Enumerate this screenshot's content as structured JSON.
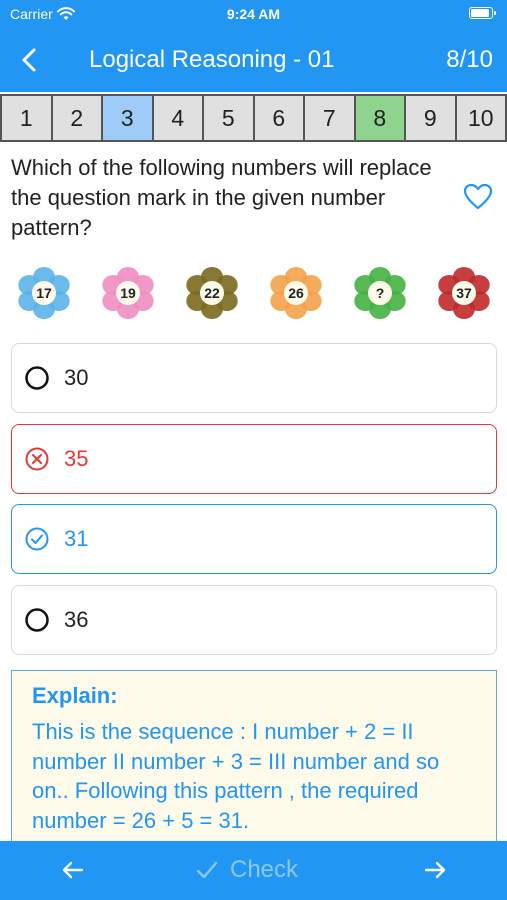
{
  "status_bar": {
    "carrier": "Carrier",
    "time": "9:24 AM"
  },
  "nav": {
    "title": "Logical Reasoning - 01",
    "progress": "8/10"
  },
  "number_strip": [
    {
      "label": "1",
      "state": "default"
    },
    {
      "label": "2",
      "state": "default"
    },
    {
      "label": "3",
      "state": "active"
    },
    {
      "label": "4",
      "state": "default"
    },
    {
      "label": "5",
      "state": "default"
    },
    {
      "label": "6",
      "state": "default"
    },
    {
      "label": "7",
      "state": "default"
    },
    {
      "label": "8",
      "state": "done"
    },
    {
      "label": "9",
      "state": "default"
    },
    {
      "label": "10",
      "state": "default"
    }
  ],
  "question": {
    "text": "Which of the following numbers will replace the question mark in the given number pattern?"
  },
  "flowers": [
    {
      "label": "17",
      "color": "#5bb3ea"
    },
    {
      "label": "19",
      "color": "#ee8ec0"
    },
    {
      "label": "22",
      "color": "#7a6a1e"
    },
    {
      "label": "26",
      "color": "#f4a24a"
    },
    {
      "label": "?",
      "color": "#45b044"
    },
    {
      "label": "37",
      "color": "#c0292b"
    }
  ],
  "options": [
    {
      "label": "30",
      "state": "normal"
    },
    {
      "label": "35",
      "state": "wrong"
    },
    {
      "label": "31",
      "state": "right"
    },
    {
      "label": "36",
      "state": "normal"
    }
  ],
  "explain": {
    "title": "Explain:",
    "text": "This is the sequence : I number + 2 = II number II number + 3 = III number and so on.. Following this pattern , the required number = 26 + 5 = 31."
  },
  "bottom_bar": {
    "check_label": "Check"
  },
  "colors": {
    "primary": "#2196f3",
    "wrong": "#e53935",
    "active_cell": "#9ecbf7",
    "done_cell": "#8ed38e",
    "explain_bg": "#fffbeb"
  },
  "icons": [
    "wifi-icon",
    "battery-icon",
    "chevron-left-icon",
    "heart-icon",
    "radio-empty-icon",
    "x-circle-icon",
    "check-circle-icon",
    "arrow-left-icon",
    "check-icon",
    "arrow-right-icon"
  ]
}
